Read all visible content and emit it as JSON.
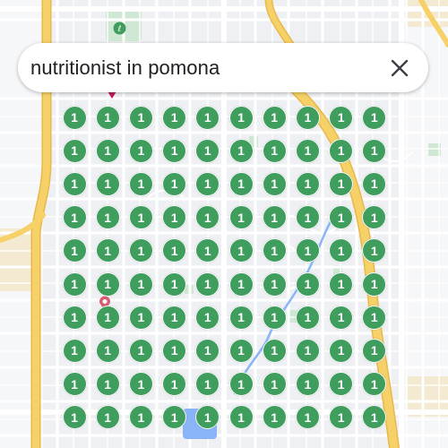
{
  "search": {
    "query": "nutritionist in pomona"
  },
  "icons": {
    "close": "close-icon",
    "map_pin": "map-pin-icon",
    "park": "park-icon"
  },
  "colors": {
    "marker_fill": "#3f9d5d",
    "marker_text": "#ffffff",
    "highway": "#f5d168",
    "water": "#8ab4f8",
    "park_green": "#cfe8d3",
    "pin_red": "#d95c72"
  },
  "grid": {
    "rows": 10,
    "cols": 10,
    "marker_label": "1"
  }
}
